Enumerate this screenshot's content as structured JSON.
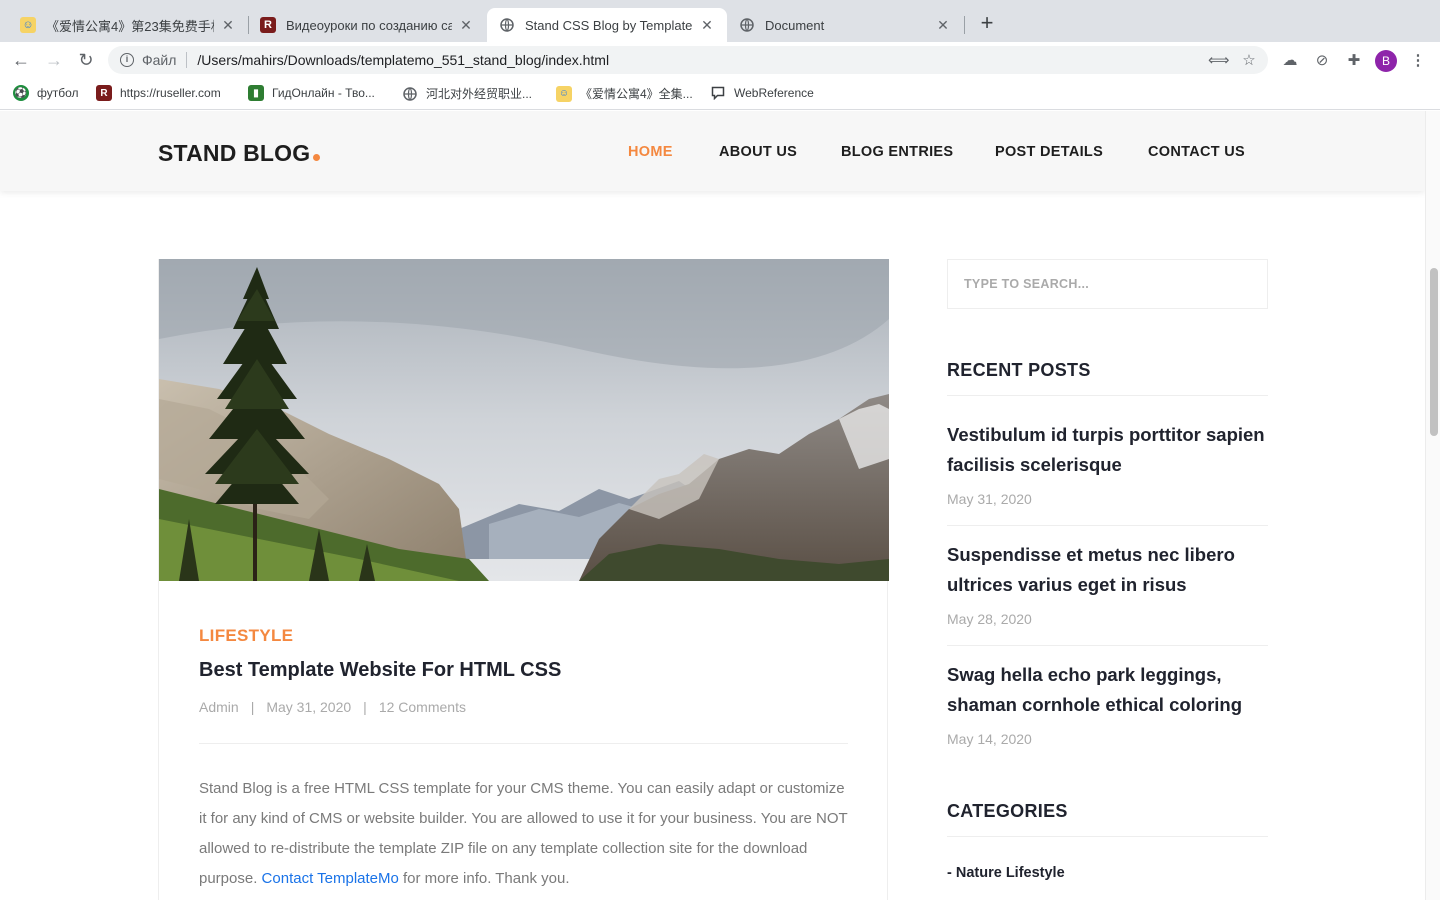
{
  "browser": {
    "tabs": [
      {
        "title": "《爱情公寓4》第23集免费手机在线观看",
        "favicon": "cartoon-favicon-icon"
      },
      {
        "title": "Видеоуроки по созданию сайтов",
        "favicon": "r-letter-favicon-icon"
      },
      {
        "title": "Stand CSS Blog by TemplateMo",
        "favicon": "globe-icon",
        "active": true
      },
      {
        "title": "Document",
        "favicon": "globe-icon"
      }
    ],
    "new_tab": "+",
    "address": {
      "protocol_label": "Файл",
      "url": "/Users/mahirs/Downloads/templatemo_551_stand_blog/index.html"
    },
    "profile_initial": "B",
    "bookmarks": [
      {
        "label": "футбол"
      },
      {
        "label": "https://ruseller.com"
      },
      {
        "label": "ГидОнлайн - Тво..."
      },
      {
        "label": "河北对外经贸职业..."
      },
      {
        "label": "《爱情公寓4》全集..."
      },
      {
        "label": "WebReference"
      }
    ]
  },
  "site": {
    "logo": "STAND BLOG",
    "accent_color": "#f48840",
    "nav": [
      {
        "label": "HOME",
        "active": true
      },
      {
        "label": "ABOUT US"
      },
      {
        "label": "BLOG ENTRIES"
      },
      {
        "label": "POST DETAILS"
      },
      {
        "label": "CONTACT US"
      }
    ]
  },
  "post": {
    "category": "LIFESTYLE",
    "title": "Best Template Website For HTML CSS",
    "author": "Admin",
    "date": "May 31, 2020",
    "comments": "12 Comments",
    "body_text": "Stand Blog is a free HTML CSS template for your CMS theme. You can easily adapt or customize it for any kind of CMS or website builder. You are allowed to use it for your business. You are NOT allowed to re-distribute the template ZIP file on any template collection site for the download purpose. ",
    "link_text": "Contact TemplateMo",
    "body_tail": " for more info. Thank you."
  },
  "sidebar": {
    "search_placeholder": "TYPE TO SEARCH...",
    "recent_heading": "RECENT POSTS",
    "recent_posts": [
      {
        "title": "Vestibulum id turpis porttitor sapien facilisis scelerisque",
        "date": "May 31, 2020"
      },
      {
        "title": "Suspendisse et metus nec libero ultrices varius eget in risus",
        "date": "May 28, 2020"
      },
      {
        "title": "Swag hella echo park leggings, shaman cornhole ethical coloring",
        "date": "May 14, 2020"
      }
    ],
    "categories_heading": "CATEGORIES",
    "categories": [
      "- Nature Lifestyle"
    ]
  }
}
